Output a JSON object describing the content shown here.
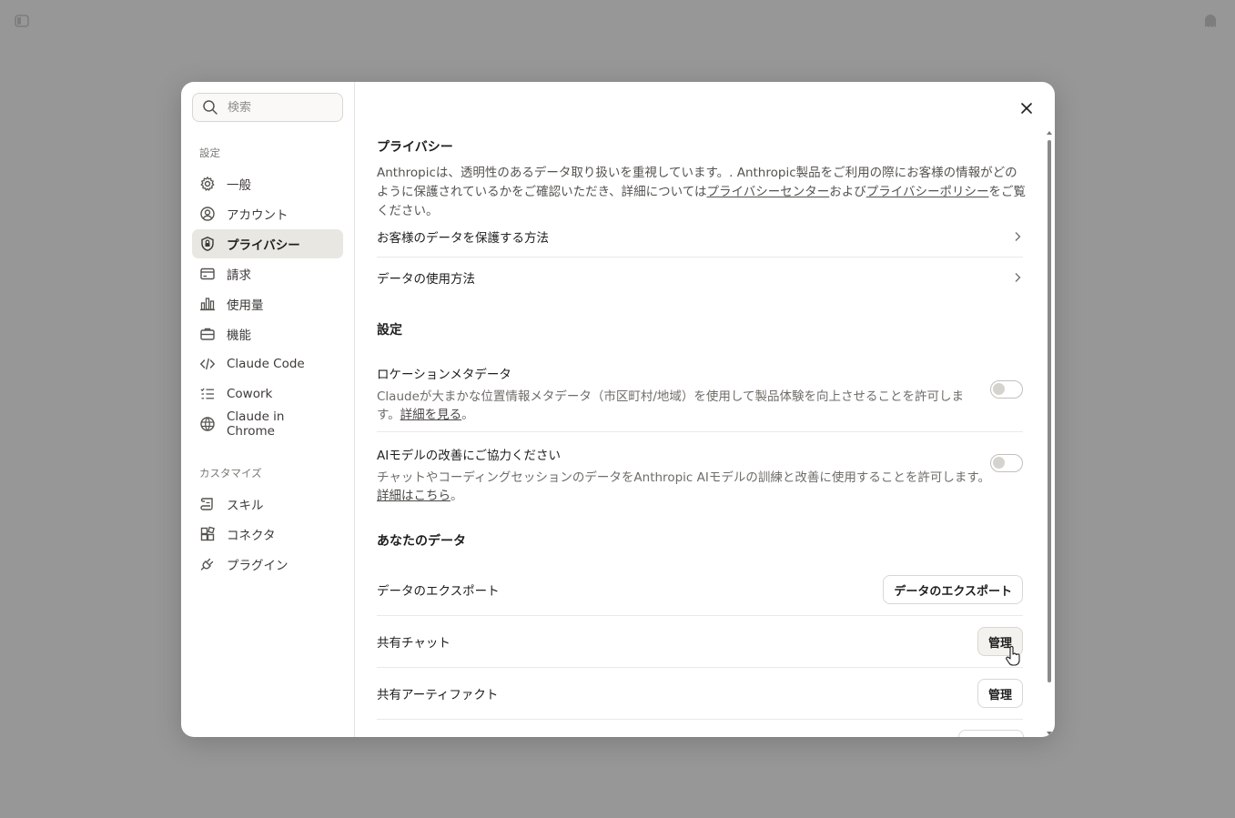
{
  "sidebar": {
    "search_placeholder": "検索",
    "section_settings": "設定",
    "items": [
      {
        "label": "一般",
        "icon": "gear-icon"
      },
      {
        "label": "アカウント",
        "icon": "user-circle-icon"
      },
      {
        "label": "プライバシー",
        "icon": "shield-lock-icon",
        "active": true
      },
      {
        "label": "請求",
        "icon": "credit-card-icon"
      },
      {
        "label": "使用量",
        "icon": "bar-chart-icon"
      },
      {
        "label": "機能",
        "icon": "briefcase-icon"
      },
      {
        "label": "Claude Code",
        "icon": "code-icon"
      },
      {
        "label": "Cowork",
        "icon": "checklist-icon"
      },
      {
        "label": "Claude in Chrome",
        "icon": "globe-icon"
      }
    ],
    "section_customize": "カスタマイズ",
    "customize_items": [
      {
        "label": "スキル",
        "icon": "scroll-icon"
      },
      {
        "label": "コネクタ",
        "icon": "blocks-icon"
      },
      {
        "label": "プラグイン",
        "icon": "plug-icon"
      }
    ]
  },
  "privacy": {
    "title": "プライバシー",
    "intro_before": "Anthropicは、透明性のあるデータ取り扱いを重視しています。. Anthropic製品をご利用の際にお客様の情報がどのように保護されているかをご確認いただき、詳細については",
    "intro_link1": "プライバシーセンター",
    "intro_middle": "および",
    "intro_link2": "プライバシーポリシー",
    "intro_after": "をご覧ください。",
    "nav_protect": "お客様のデータを保護する方法",
    "nav_usage": "データの使用方法"
  },
  "settings": {
    "title": "設定",
    "location": {
      "title": "ロケーションメタデータ",
      "desc": "Claudeが大まかな位置情報メタデータ（市区町村/地域）を使用して製品体験を向上させることを許可します。",
      "link": "詳細を見る",
      "end": "。",
      "enabled": false
    },
    "model": {
      "title": "AIモデルの改善にご協力ください",
      "desc": "チャットやコーディングセッションのデータをAnthropic AIモデルの訓練と改善に使用することを許可します。",
      "link": "詳細はこちら",
      "end": "。",
      "enabled": false
    }
  },
  "your_data": {
    "title": "あなたのデータ",
    "export_label": "データのエクスポート",
    "export_button": "データのエクスポート",
    "shared_chats_label": "共有チャット",
    "shared_chats_button": "管理",
    "shared_artifacts_label": "共有アーティファクト",
    "shared_artifacts_button": "管理"
  }
}
